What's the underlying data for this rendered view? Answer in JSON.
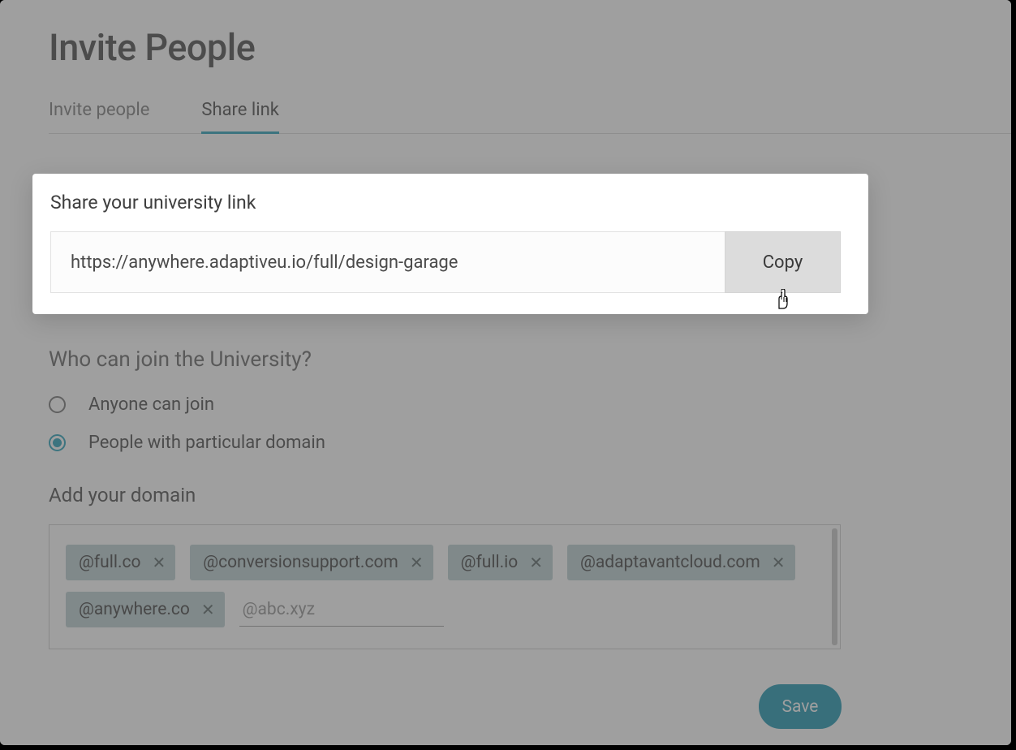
{
  "page": {
    "title": "Invite People"
  },
  "tabs": {
    "invite": "Invite people",
    "share": "Share link"
  },
  "share": {
    "heading": "Share your university link",
    "url": "https://anywhere.adaptiveu.io/full/design-garage",
    "copy": "Copy"
  },
  "access": {
    "heading": "Who can join the University?",
    "anyone": "Anyone can join",
    "domain": "People with particular domain"
  },
  "domains": {
    "heading": "Add your domain",
    "chips": [
      "@full.co",
      "@conversionsupport.com",
      "@full.io",
      "@adaptavantcloud.com",
      "@anywhere.co"
    ],
    "placeholder": "@abc.xyz"
  },
  "actions": {
    "save": "Save"
  }
}
